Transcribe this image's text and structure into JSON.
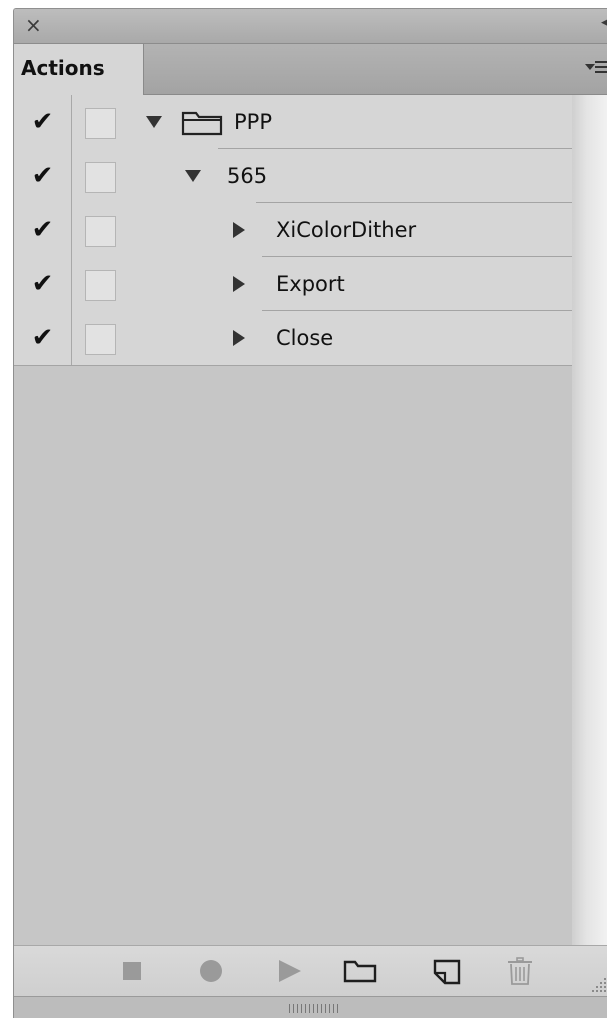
{
  "panel": {
    "tab_label": "Actions",
    "close_glyph": "×",
    "collapse_glyph": "◂◂"
  },
  "actions": [
    {
      "check": "✔",
      "label": "PPP",
      "kind": "set",
      "expanded": true,
      "depth": 0
    },
    {
      "check": "✔",
      "label": "565",
      "kind": "action",
      "expanded": true,
      "depth": 1
    },
    {
      "check": "✔",
      "label": "XiColorDither",
      "kind": "step",
      "expanded": false,
      "depth": 2
    },
    {
      "check": "✔",
      "label": "Export",
      "kind": "step",
      "expanded": false,
      "depth": 2
    },
    {
      "check": "✔",
      "label": "Close",
      "kind": "step",
      "expanded": false,
      "depth": 2
    }
  ],
  "toolbar": {
    "buttons": [
      "stop-icon",
      "record-icon",
      "play-icon",
      "new-set-folder-icon",
      "new-action-icon",
      "trash-icon"
    ]
  },
  "colors": {
    "panel_bg": "#c6c6c6",
    "row_bg": "#d6d6d6",
    "icon_disabled": "#9a9a9a"
  }
}
